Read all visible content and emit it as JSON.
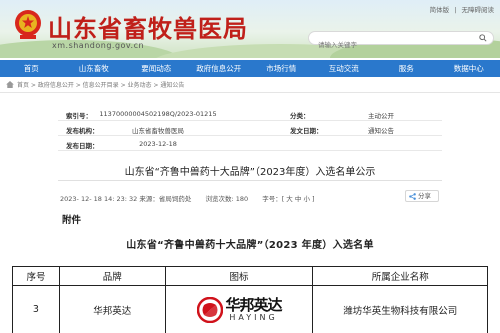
{
  "header": {
    "site_title": "山东省畜牧兽医局",
    "domain": "xm.shandong.gov.cn",
    "top_links": [
      "简体版",
      "|",
      "无障碍阅读"
    ],
    "search_placeholder": "请输入关键字"
  },
  "nav": [
    "首页",
    "山东畜牧",
    "要闻动态",
    "政府信息公开",
    "市场行情",
    "互动交流",
    "服务",
    "数据中心"
  ],
  "breadcrumb": "首页 > 政府信息公开 > 信息公开目录 > 业务动态 > 通知公告",
  "meta": {
    "rows": [
      {
        "label": "索引号：",
        "value": "11370000004502198Q/2023-01215",
        "label2": "分类：",
        "value2": "主动公开"
      },
      {
        "label": "发布机构：",
        "value": "山东省畜牧兽医局",
        "label2": "发文日期：",
        "value2": "通知公告"
      },
      {
        "label": "发布日期：",
        "value": "2023-12-18",
        "label2": "",
        "value2": ""
      }
    ]
  },
  "article": {
    "title": "山东省“齐鲁中兽药十大品牌”（2023年度）入选名单公示",
    "date": "2023- 12- 18 14: 23: 32 来源：省局饲药处",
    "views": "浏览次数: 180",
    "font_size": "字号：[ 大 中 小 ]",
    "share": "分享",
    "attachment": "附件",
    "list_title": "山东省“齐鲁中兽药十大品牌”（2023 年度）入选名单"
  },
  "table": {
    "headers": [
      "序号",
      "品牌",
      "图标",
      "所属企业名称"
    ],
    "rows": [
      {
        "index": "3",
        "brand": "华邦英达",
        "logo_cn": "华邦英达",
        "logo_en": "HAYING",
        "company": "潍坊华英生物科技有限公司"
      }
    ]
  },
  "colors": {
    "nav_bg": "#2a78cc",
    "title_red": "#c0201a",
    "logo_red": "#d0121b"
  }
}
